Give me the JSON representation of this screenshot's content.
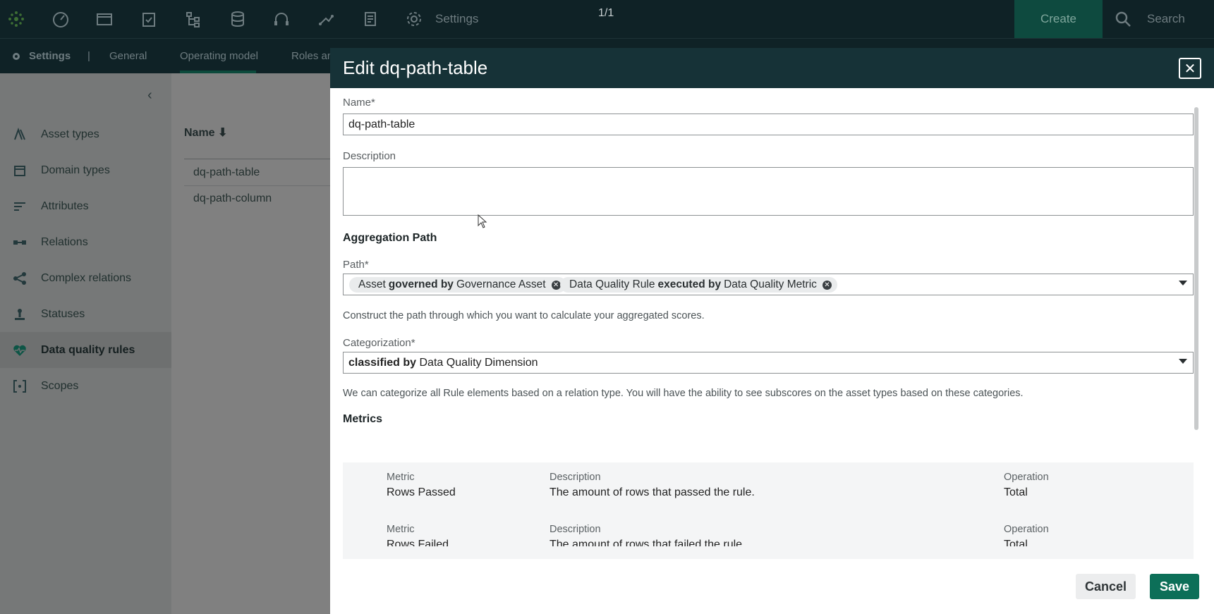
{
  "topbar": {
    "icons": [
      "app-logo-icon",
      "dashboard-icon",
      "folder-icon",
      "clipboard-icon",
      "hierarchy-icon",
      "database-icon",
      "headset-icon",
      "workflow-icon",
      "report-icon",
      "gear-icon"
    ],
    "settings_label": "Settings",
    "page_count": "1/1",
    "create_label": "Create",
    "search_label": "Search"
  },
  "subnav": {
    "settings_label": "Settings",
    "separator": "|",
    "tabs": [
      {
        "label": "General"
      },
      {
        "label": "Operating model"
      },
      {
        "label": "Roles an"
      }
    ]
  },
  "sidebar": {
    "items": [
      {
        "label": "Asset types",
        "icon": "asset-types-icon"
      },
      {
        "label": "Domain types",
        "icon": "domain-types-icon"
      },
      {
        "label": "Attributes",
        "icon": "attributes-icon"
      },
      {
        "label": "Relations",
        "icon": "relations-icon"
      },
      {
        "label": "Complex relations",
        "icon": "complex-relations-icon"
      },
      {
        "label": "Statuses",
        "icon": "statuses-icon"
      },
      {
        "label": "Data quality rules",
        "icon": "heart-pulse-icon"
      },
      {
        "label": "Scopes",
        "icon": "scopes-icon"
      }
    ]
  },
  "table": {
    "header": "Name ⬇",
    "rows": [
      "dq-path-table",
      "dq-path-column"
    ]
  },
  "modal": {
    "title": "Edit dq-path-table",
    "name_label": "Name*",
    "name_value": "dq-path-table",
    "description_label": "Description",
    "description_value": "",
    "aggregation_title": "Aggregation Path",
    "path_label": "Path*",
    "path_chips": [
      {
        "pre": "Asset",
        "rel": "governed by",
        "post": "Governance Asset"
      },
      {
        "pre": "Data Quality Rule",
        "rel": "executed by",
        "post": "Data Quality Metric"
      }
    ],
    "path_helper": "Construct the path through which you want to calculate your aggregated scores.",
    "categorization_label": "Categorization*",
    "categorization_rel": "classified by",
    "categorization_value": "Data Quality Dimension",
    "categorization_helper": "We can categorize all Rule elements based on a relation type. You will have the ability to see subscores on the asset types based on these categories.",
    "metrics_title": "Metrics",
    "metric_caption": "Metric",
    "description_caption": "Description",
    "operation_caption": "Operation",
    "metrics": [
      {
        "metric": "Rows Passed",
        "description": "The amount of rows that passed the rule.",
        "operation": "Total"
      },
      {
        "metric": "Rows Failed",
        "description": "The amount of rows that failed the rule.",
        "operation": "Total"
      }
    ],
    "cancel_label": "Cancel",
    "save_label": "Save"
  },
  "colors": {
    "nav_bg": "#0f2226",
    "modal_header": "#163237",
    "primary": "#0c6f58",
    "overlay": "#7f7f7f"
  }
}
